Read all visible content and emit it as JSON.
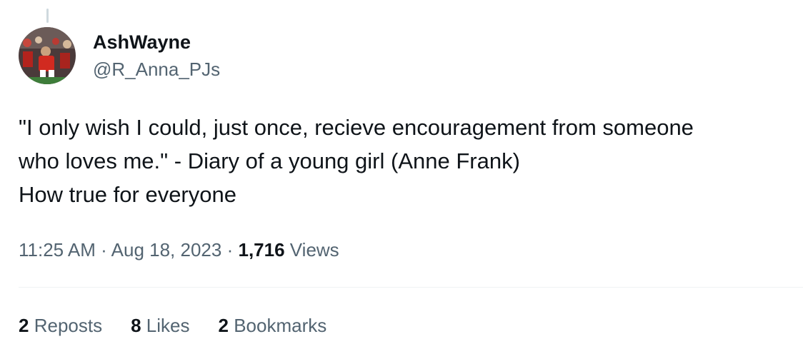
{
  "author": {
    "display_name": "AshWayne",
    "handle": "@R_Anna_PJs"
  },
  "tweet": {
    "lines": [
      "\"I only wish I could, just once, recieve encouragement from someone",
      "who loves me.\" - Diary of a young girl (Anne Frank)",
      "How true for everyone"
    ],
    "time": "11:25 AM",
    "date": "Aug 18, 2023",
    "separator": "·",
    "views_count": "1,716",
    "views_label": "Views"
  },
  "stats": {
    "reposts_count": "2",
    "reposts_label": "Reposts",
    "likes_count": "8",
    "likes_label": "Likes",
    "bookmarks_count": "2",
    "bookmarks_label": "Bookmarks"
  },
  "colors": {
    "primary_text": "#0f1419",
    "secondary_text": "#536471",
    "divider": "#eff3f4"
  }
}
